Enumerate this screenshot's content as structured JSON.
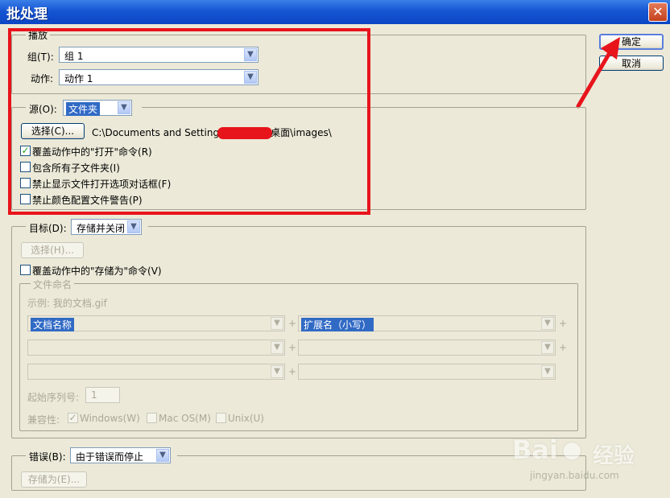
{
  "window": {
    "title": "批处理",
    "close_glyph": "✕"
  },
  "buttons": {
    "ok": "确定",
    "cancel": "取消"
  },
  "play": {
    "legend": "播放",
    "set_label": "组(T):",
    "set_value": "组 1",
    "action_label": "动作:",
    "action_value": "动作 1"
  },
  "source": {
    "label": "源(O):",
    "value": "文件夹",
    "choose": "选择(C)...",
    "path_prefix": "C:\\Documents and Setting",
    "path_suffix": "桌面\\images\\",
    "options": [
      {
        "label": "覆盖动作中的\"打开\"命令(R)",
        "checked": true
      },
      {
        "label": "包含所有子文件夹(I)",
        "checked": false
      },
      {
        "label": "禁止显示文件打开选项对话框(F)",
        "checked": false
      },
      {
        "label": "禁止颜色配置文件警告(P)",
        "checked": false
      }
    ]
  },
  "destination": {
    "label": "目标(D):",
    "value": "存储并关闭",
    "choose": "选择(H)...",
    "override_label": "覆盖动作中的\"存储为\"命令(V)",
    "naming": {
      "legend": "文件命名",
      "example": "示例: 我的文档.gif",
      "row1_left": "文档名称",
      "row1_right": "扩展名（小写）",
      "plus": "+",
      "serial_label": "起始序列号:",
      "serial_value": "1",
      "compat_label": "兼容性:",
      "compat": [
        {
          "label": "Windows(W)",
          "checked": true
        },
        {
          "label": "Mac OS(M)",
          "checked": false
        },
        {
          "label": "Unix(U)",
          "checked": false
        }
      ]
    }
  },
  "errors": {
    "label": "错误(B):",
    "value": "由于错误而停止",
    "save_as": "存储为(E)..."
  },
  "watermark": {
    "brand": "Bai",
    "brand2": "经验",
    "url": "jingyan.baidu.com"
  },
  "colors": {
    "annotation_red": "#e8141c",
    "title_blue": "#1656d3"
  }
}
